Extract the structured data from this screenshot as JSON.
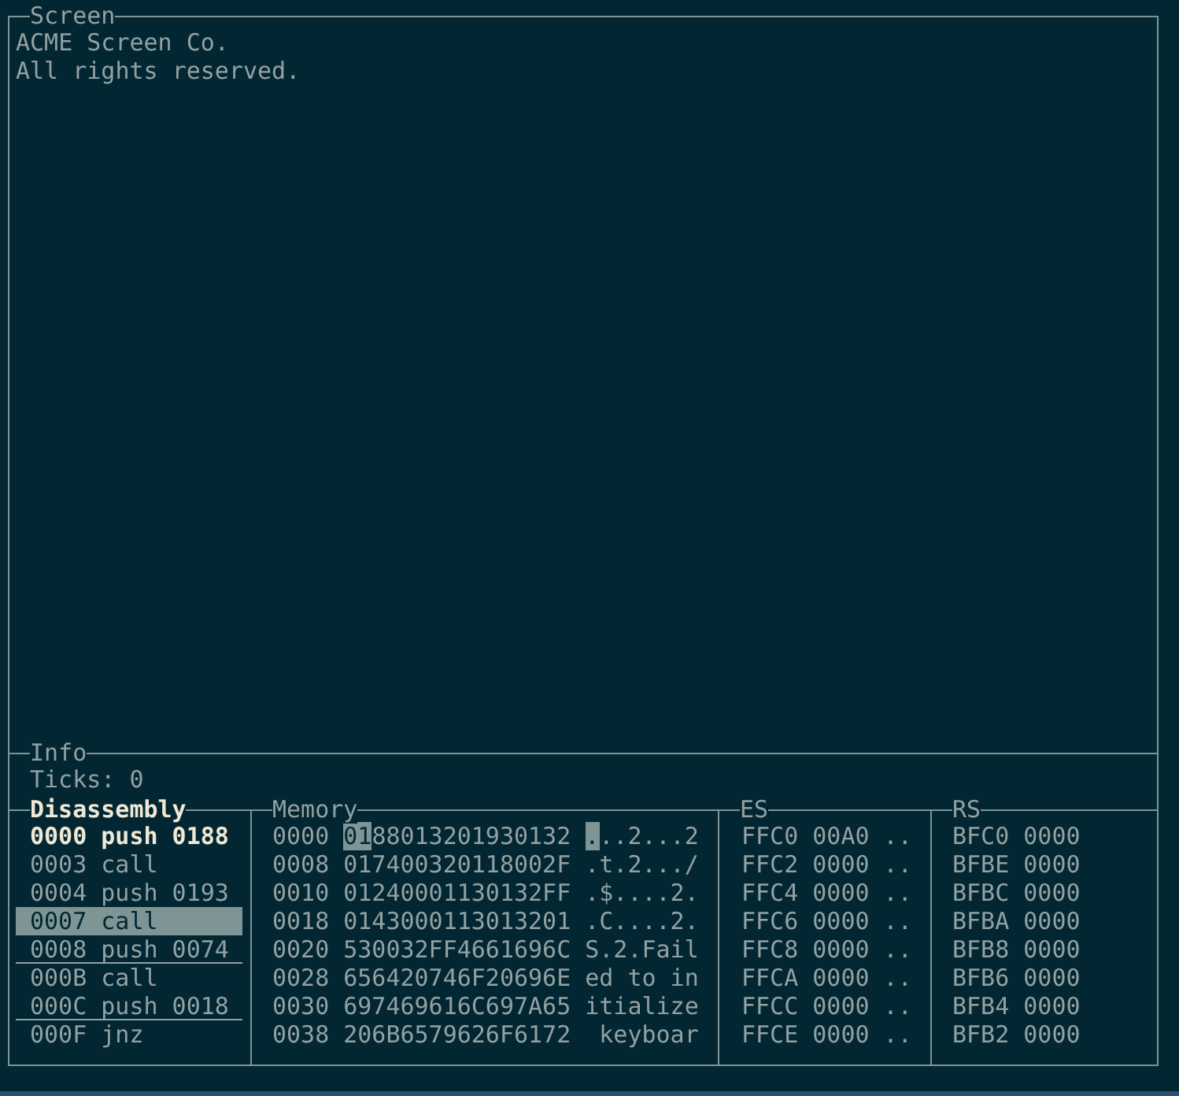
{
  "screen": {
    "title": "Screen",
    "lines": [
      "ACME Screen Co.",
      "All rights reserved."
    ]
  },
  "info": {
    "title": "Info",
    "ticks": "Ticks: 0"
  },
  "disassembly": {
    "title": "Disassembly",
    "rows": [
      {
        "text": "0000 push 0188",
        "current": true,
        "selected": false,
        "breakpoint": false
      },
      {
        "text": "0003 call",
        "current": false,
        "selected": false,
        "breakpoint": false
      },
      {
        "text": "0004 push 0193",
        "current": false,
        "selected": false,
        "breakpoint": false
      },
      {
        "text": "0007 call",
        "current": false,
        "selected": true,
        "breakpoint": false
      },
      {
        "text": "0008 push 0074",
        "current": false,
        "selected": false,
        "breakpoint": true
      },
      {
        "text": "000B call",
        "current": false,
        "selected": false,
        "breakpoint": false
      },
      {
        "text": "000C push 0018",
        "current": false,
        "selected": false,
        "breakpoint": true
      },
      {
        "text": "000F jnz",
        "current": false,
        "selected": false,
        "breakpoint": false
      }
    ]
  },
  "memory": {
    "title": "Memory",
    "rows": [
      {
        "address": "0000",
        "hex": "0188013201930132",
        "ascii": "...2...2",
        "cursor": true
      },
      {
        "address": "0008",
        "hex": "017400320118002F",
        "ascii": ".t.2.../",
        "cursor": false
      },
      {
        "address": "0010",
        "hex": "01240001130132FF",
        "ascii": ".$....2.",
        "cursor": false
      },
      {
        "address": "0018",
        "hex": "0143000113013201",
        "ascii": ".C....2.",
        "cursor": false
      },
      {
        "address": "0020",
        "hex": "530032FF4661696C",
        "ascii": "S.2.Fail",
        "cursor": false
      },
      {
        "address": "0028",
        "hex": "656420746F20696E",
        "ascii": "ed to in",
        "cursor": false
      },
      {
        "address": "0030",
        "hex": "697469616C697A65",
        "ascii": "itialize",
        "cursor": false
      },
      {
        "address": "0038",
        "hex": "206B6579626F6172",
        "ascii": " keyboar",
        "cursor": false
      }
    ]
  },
  "es": {
    "title": "ES",
    "rows": [
      "FFC0 00A0 ..",
      "FFC2 0000 ..",
      "FFC4 0000 ..",
      "FFC6 0000 ..",
      "FFC8 0000 ..",
      "FFCA 0000 ..",
      "FFCC 0000 ..",
      "FFCE 0000 .."
    ]
  },
  "rs": {
    "title": "RS",
    "rows": [
      "BFC0 0000",
      "BFBE 0000",
      "BFBC 0000",
      "BFBA 0000",
      "BFB8 0000",
      "BFB6 0000",
      "BFB4 0000",
      "BFB2 0000"
    ]
  }
}
